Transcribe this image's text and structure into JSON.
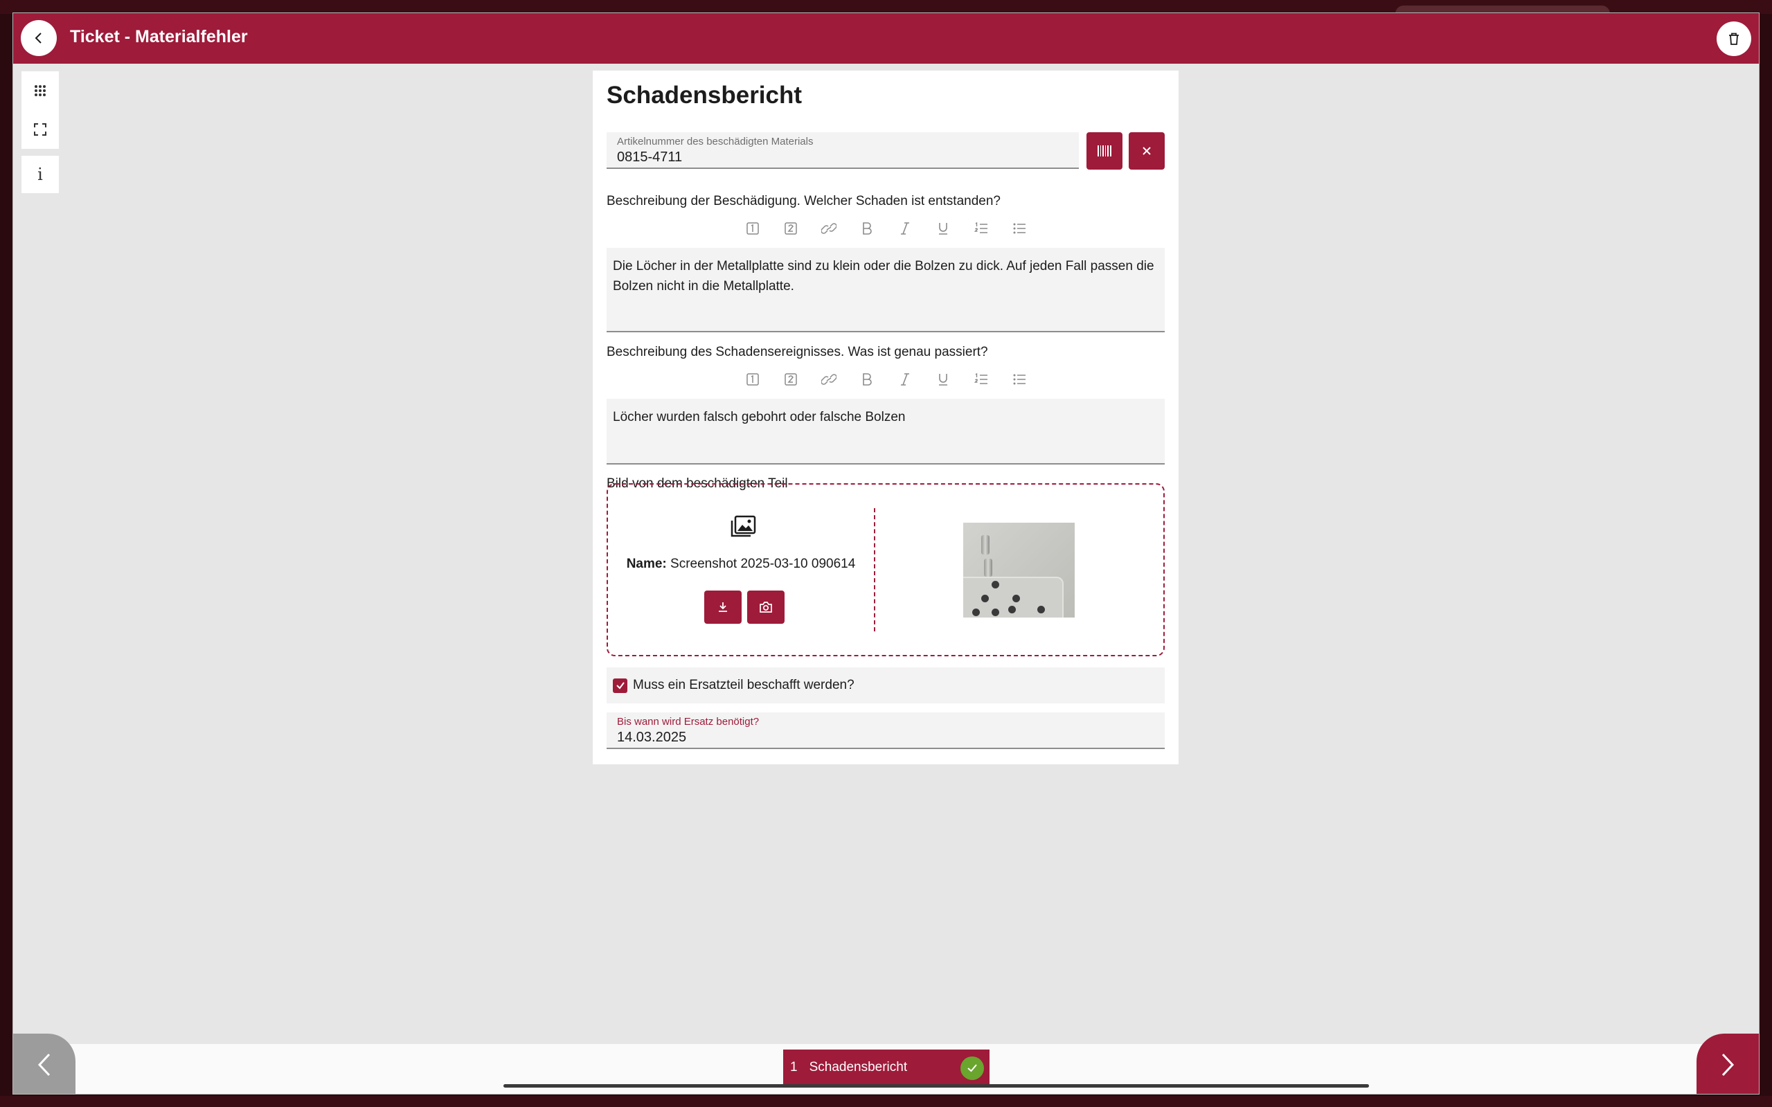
{
  "header": {
    "title": "Ticket - Materialfehler"
  },
  "form": {
    "title": "Schadensbericht",
    "article": {
      "label": "Artikelnummer des beschädigten Materials",
      "value": "0815-4711"
    },
    "damage_description": {
      "label": "Beschreibung der Beschädigung. Welcher Schaden ist entstanden?",
      "text": "Die Löcher in der Metallplatte sind zu klein oder die Bolzen zu dick. Auf jeden Fall passen die Bolzen nicht in die Metallplatte."
    },
    "event_description": {
      "label": "Beschreibung des Schadensereignisses. Was ist genau passiert?",
      "text": "Löcher wurden falsch gebohrt oder falsche Bolzen"
    },
    "image": {
      "label": "Bild von dem beschädigten Teil",
      "name_label": "Name:",
      "file_name": "Screenshot 2025-03-10 090614"
    },
    "replacement": {
      "checkbox_label": "Muss ein Ersatzteil beschafft werden?",
      "checked": true
    },
    "date": {
      "label": "Bis wann wird Ersatz benötigt?",
      "value": "14.03.2025"
    }
  },
  "toolbar_icons": [
    "heading-1-icon",
    "heading-2-icon",
    "link-icon",
    "bold-icon",
    "italic-icon",
    "underline-icon",
    "ordered-list-icon",
    "bullet-list-icon"
  ],
  "steps": [
    {
      "number": "1",
      "label": "Schadensbericht",
      "complete": true
    }
  ],
  "colors": {
    "brand": "#9e1b3a",
    "success": "#6aa52e",
    "background": "#e6e6e6"
  }
}
